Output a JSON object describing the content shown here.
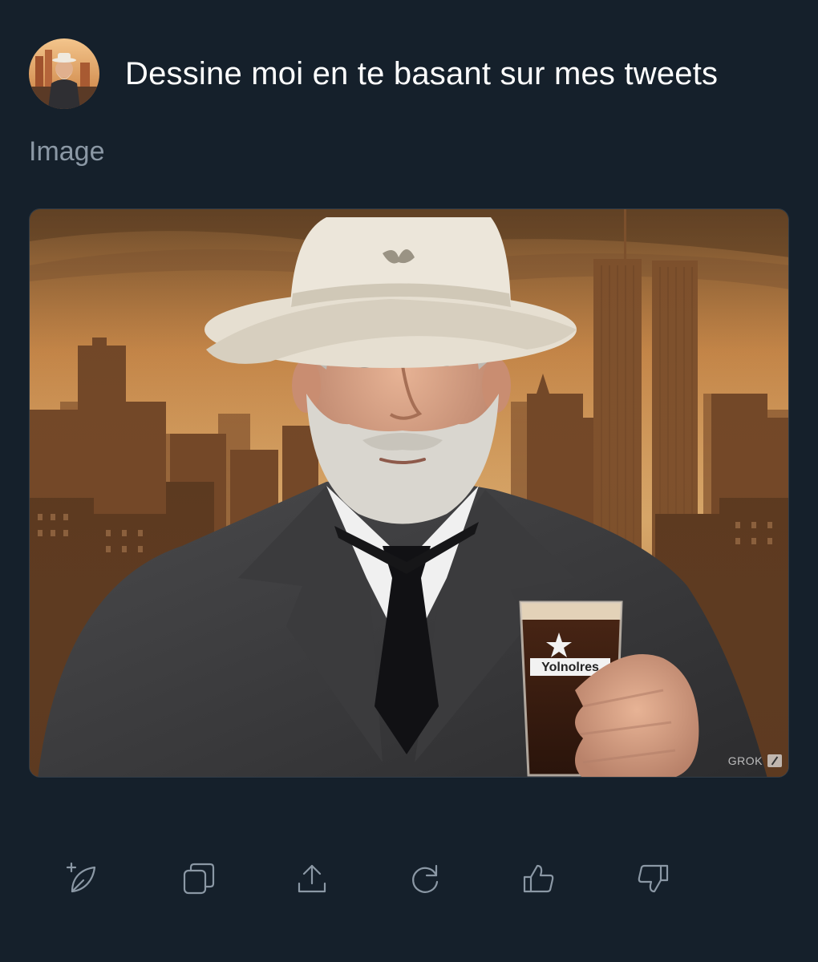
{
  "header": {
    "prompt": "Dessine moi en te basant sur mes tweets"
  },
  "section_label": "Image",
  "generated_image": {
    "watermark": "GROK",
    "glass_label": "Yolnolres"
  },
  "actions": [
    {
      "icon": "new-image-icon"
    },
    {
      "icon": "copy-icon"
    },
    {
      "icon": "share-icon"
    },
    {
      "icon": "regenerate-icon"
    },
    {
      "icon": "thumbs-up-icon"
    },
    {
      "icon": "thumbs-down-icon"
    }
  ],
  "colors": {
    "background": "#15202b",
    "text_primary": "#ffffff",
    "text_secondary": "#8b98a5"
  }
}
